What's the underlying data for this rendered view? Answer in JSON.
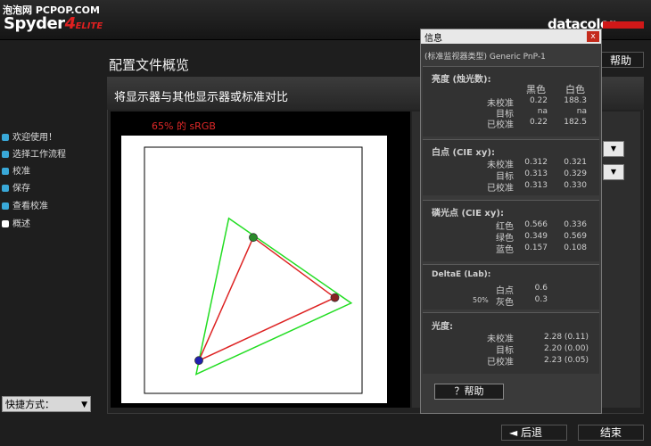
{
  "watermark": "泡泡网 PCPOP.COM",
  "app": {
    "name": "Spyder",
    "num": "4",
    "edition": "ELITE",
    "brand": "datacolor"
  },
  "nav": {
    "items": [
      {
        "label": "欢迎使用！"
      },
      {
        "label": "选择工作流程"
      },
      {
        "label": "校准"
      },
      {
        "label": "保存"
      },
      {
        "label": "查看校准"
      },
      {
        "label": "概述"
      }
    ]
  },
  "shortcut": {
    "label": "快捷方式："
  },
  "page": {
    "title": "配置文件概览",
    "panel_title": "将显示器与其他显示器或标准对比",
    "help": "帮助"
  },
  "chart": {
    "caption": "65% 的 sRGB"
  },
  "chart_data": {
    "type": "scatter",
    "series": [
      {
        "name": "",
        "color": "#22dd22",
        "x": [
          0.31,
          0.76,
          0.19
        ],
        "y": [
          0.64,
          0.33,
          0.07
        ]
      },
      {
        "name": "",
        "color": "#dd2222",
        "x": [
          0.4,
          0.7,
          0.2
        ],
        "y": [
          0.57,
          0.35,
          0.12
        ]
      }
    ],
    "points": [
      {
        "color": "#2a8a2a",
        "x": 0.4,
        "y": 0.57
      },
      {
        "color": "#8a2222",
        "x": 0.7,
        "y": 0.35
      },
      {
        "color": "#2020b0",
        "x": 0.2,
        "y": 0.12
      }
    ],
    "xlim": [
      0,
      0.8
    ],
    "ylim": [
      0,
      0.9
    ]
  },
  "info": {
    "title": "信息",
    "close": "x",
    "monitor": "(标准监视器类型) Generic PnP-1",
    "luminance": {
      "header": "亮度 (烛光数):",
      "col_black": "黑色",
      "col_white": "白色",
      "rows": [
        {
          "label": "未校准",
          "black": "0.22",
          "white": "188.3"
        },
        {
          "label": "目标",
          "black": "na",
          "white": "na"
        },
        {
          "label": "已校准",
          "black": "0.22",
          "white": "182.5"
        }
      ]
    },
    "whitepoint": {
      "header": "白点 (CIE xy):",
      "rows": [
        {
          "label": "未校准",
          "x": "0.312",
          "y": "0.321"
        },
        {
          "label": "目标",
          "x": "0.313",
          "y": "0.329"
        },
        {
          "label": "已校准",
          "x": "0.313",
          "y": "0.330"
        }
      ]
    },
    "phosphor": {
      "header": "磷光点 (CIE xy):",
      "rows": [
        {
          "label": "红色",
          "x": "0.566",
          "y": "0.336"
        },
        {
          "label": "绿色",
          "x": "0.349",
          "y": "0.569"
        },
        {
          "label": "蓝色",
          "x": "0.157",
          "y": "0.108"
        }
      ]
    },
    "deltae": {
      "header": "DeltaE (Lab):",
      "rows": [
        {
          "label": "白点",
          "prefix": "",
          "value": "0.6"
        },
        {
          "label": "灰色",
          "prefix": "50%",
          "value": "0.3"
        }
      ]
    },
    "gamma": {
      "header": "光度:",
      "rows": [
        {
          "label": "未校准",
          "value": "2.28 (0.11)"
        },
        {
          "label": "目标",
          "value": "2.20 (0.00)"
        },
        {
          "label": "已校准",
          "value": "2.23 (0.05)"
        }
      ]
    },
    "help": "？帮助"
  },
  "footer": {
    "back": "◄ 后退",
    "finish": "结束"
  }
}
